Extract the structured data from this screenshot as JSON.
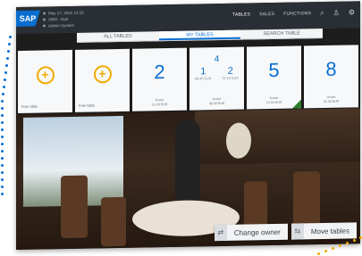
{
  "header": {
    "logo": "SAP",
    "info_lines": [
      "May 17, 2021 14:15",
      "3990 - Hall",
      "Admin System"
    ],
    "nav": [
      {
        "label": "TABLES",
        "active": true
      },
      {
        "label": "SALES",
        "active": false
      },
      {
        "label": "FUNCTIONS",
        "active": false
      }
    ],
    "icons": [
      "search-icon",
      "user-icon",
      "settings-icon"
    ]
  },
  "tabs": [
    {
      "label": "ALL TABLES",
      "active": false
    },
    {
      "label": "MY TABLES",
      "active": true
    },
    {
      "label": "SEARCH TABLE",
      "active": false
    }
  ],
  "tiles": [
    {
      "type": "add",
      "label": "Free table"
    },
    {
      "type": "add-alt",
      "label": "Free table"
    },
    {
      "type": "number",
      "value": "2",
      "stat_line1": "Active",
      "stat_line2": "16.30 EUR"
    },
    {
      "type": "split",
      "top": "4",
      "left": "1",
      "right": "2",
      "left_sub": "48.40 EUR",
      "right_sub": "22.10 EUR",
      "stat_line1": "Active",
      "stat_line2": "48.40 EUR"
    },
    {
      "type": "number",
      "value": "5",
      "stat_line1": "Active",
      "stat_line2": "15.90 EUR"
    },
    {
      "type": "number",
      "value": "8",
      "stat_line1": "Active",
      "stat_line2": "22.40 EUR"
    }
  ],
  "actions": {
    "change_owner": "Change owner",
    "move_tables": "Move tables"
  }
}
